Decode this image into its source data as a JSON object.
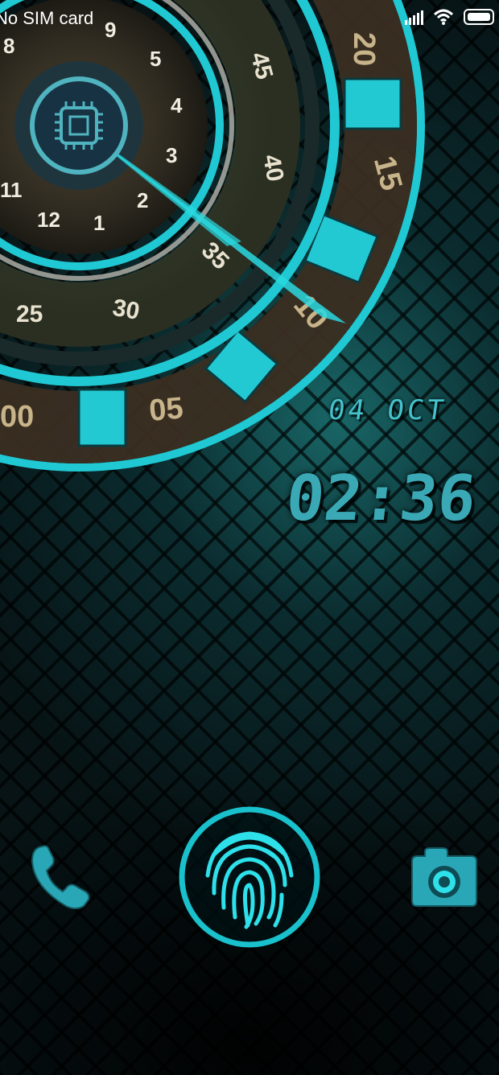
{
  "status_bar": {
    "carrier": "No SIM card",
    "icons": [
      "signal-icon",
      "wifi-icon",
      "battery-icon"
    ]
  },
  "dial": {
    "inner_numbers": [
      "8",
      "9",
      "5",
      "4",
      "3",
      "2",
      "1",
      "12",
      "11"
    ],
    "middle_numbers": [
      "45",
      "40",
      "35",
      "30",
      "25"
    ],
    "outer_numbers": [
      "20",
      "15",
      "10",
      "05",
      "00"
    ],
    "center_icon": "cpu-chip-icon"
  },
  "clock": {
    "date": "04 OCT",
    "time": "02:36"
  },
  "shortcuts": {
    "left": "phone-icon",
    "center": "fingerprint-icon",
    "right": "camera-icon"
  },
  "colors": {
    "accent": "#1fc8d2",
    "accent_dark": "#0e8e98",
    "text_clock": "#3aa9b5"
  }
}
